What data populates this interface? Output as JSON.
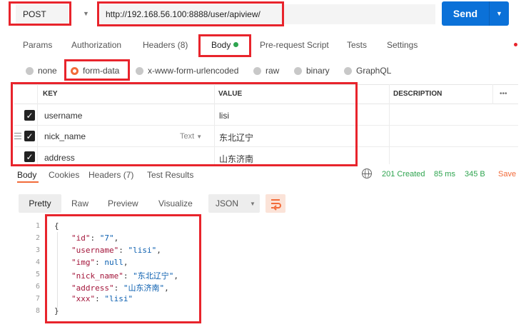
{
  "request": {
    "method": "POST",
    "url": "http://192.168.56.100:8888/user/apiview/",
    "send_label": "Send"
  },
  "tabs": [
    "Params",
    "Authorization",
    "Headers (8)",
    "Body",
    "Pre-request Script",
    "Tests",
    "Settings"
  ],
  "body_types": [
    "none",
    "form-data",
    "x-www-form-urlencoded",
    "raw",
    "binary",
    "GraphQL"
  ],
  "selected_body_type": "form-data",
  "table": {
    "headers": [
      "KEY",
      "VALUE",
      "DESCRIPTION"
    ],
    "more": "•••",
    "rows": [
      {
        "key": "username",
        "value": "lisi",
        "type": ""
      },
      {
        "key": "nick_name",
        "value": "东北辽宁",
        "type": "Text"
      },
      {
        "key": "address",
        "value": "山东济南",
        "type": ""
      }
    ]
  },
  "response": {
    "tabs": [
      "Body",
      "Cookies",
      "Headers (7)",
      "Test Results"
    ],
    "status": "201 Created",
    "time": "85 ms",
    "size": "345 B",
    "save": "Save",
    "view_tabs": [
      "Pretty",
      "Raw",
      "Preview",
      "Visualize"
    ],
    "format": "JSON",
    "line_numbers": [
      "1",
      "2",
      "3",
      "4",
      "5",
      "6",
      "7",
      "8"
    ],
    "json": {
      "open": "{",
      "close": "}",
      "lines": [
        {
          "key": "\"id\"",
          "value": "\"7\"",
          "sep": ","
        },
        {
          "key": "\"username\"",
          "value": "\"lisi\"",
          "sep": ","
        },
        {
          "key": "\"img\"",
          "value": "null",
          "sep": ","
        },
        {
          "key": "\"nick_name\"",
          "value": "\"东北辽宁\"",
          "sep": ","
        },
        {
          "key": "\"address\"",
          "value": "\"山东济南\"",
          "sep": ","
        },
        {
          "key": "\"xxx\"",
          "value": "\"lisi\"",
          "sep": ""
        }
      ]
    }
  },
  "colors": {
    "send": "#0b71d8",
    "accent": "#f26b3a",
    "status_ok": "#2ea44f",
    "highlight_box": "#e8242c"
  }
}
